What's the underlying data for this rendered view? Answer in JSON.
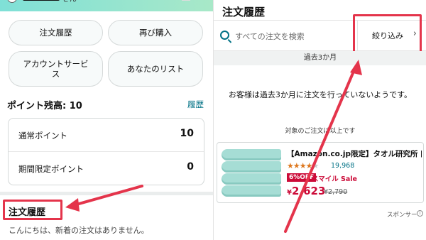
{
  "left": {
    "header": {
      "greeting_suffix": "さん",
      "language": "JA"
    },
    "buttons": {
      "order_history": "注文履歴",
      "buy_again": "再び購入",
      "account_service": "アカウントサービス",
      "your_lists": "あなたのリスト"
    },
    "points": {
      "title": "ポイント残高: 10",
      "history_link": "履歴",
      "rows": [
        {
          "label": "通常ポイント",
          "value": "10"
        },
        {
          "label": "期間限定ポイント",
          "value": "0"
        }
      ]
    },
    "order_history_section": {
      "title": "注文履歴",
      "message": "こんにちは、新着の注文はありません。"
    }
  },
  "right": {
    "title": "注文履歴",
    "search": {
      "placeholder": "すべての注文を検索"
    },
    "filter_label": "絞り込み",
    "period": "過去3か月",
    "no_orders_message": "お客様は過去3か月に注文を行っていないようです。",
    "note": "対象のご注文は以上です",
    "ad": {
      "title": "【Amazon.co.jp限定】タオル研究所 [軽…",
      "rating": 4.5,
      "review_count": "19,968",
      "discount": "6%OFF",
      "sale_label": "スマイル Sale",
      "price_symbol": "¥",
      "price": "2,623",
      "list_price": "¥2,790"
    },
    "sponsored_label": "スポンサー",
    "info_icon_glyph": "i"
  },
  "colors": {
    "highlight_red": "#e4344b",
    "link_teal": "#007185",
    "sale_red": "#cc0c39",
    "header_gradient_start": "#7fe0d7",
    "header_gradient_end": "#a8e8c8"
  }
}
